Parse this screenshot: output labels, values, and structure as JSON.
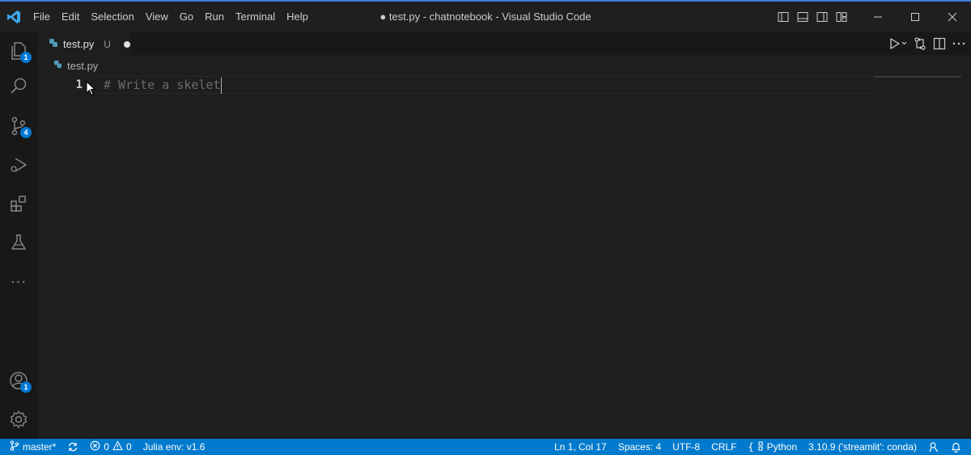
{
  "menubar": {
    "items": [
      "File",
      "Edit",
      "Selection",
      "View",
      "Go",
      "Run",
      "Terminal",
      "Help"
    ]
  },
  "window": {
    "title": "● test.py - chatnotebook - Visual Studio Code"
  },
  "activitybar": {
    "explorer_badge": "1",
    "source_control_badge": "4",
    "accounts_badge": "1",
    "more_label": "···"
  },
  "tab": {
    "label": "test.py",
    "status": "U"
  },
  "breadcrumb": {
    "file": "test.py"
  },
  "editor": {
    "line_number": "1",
    "code": "# Write a skelet"
  },
  "statusbar": {
    "branch": "master*",
    "errors": "0",
    "warnings": "0",
    "julia_env": "Julia env: v1.6",
    "position": "Ln 1, Col 17",
    "spaces": "Spaces: 4",
    "encoding": "UTF-8",
    "eol": "CRLF",
    "language": "Python",
    "interpreter": "3.10.9 ('streamlit': conda)"
  },
  "colors": {
    "accent": "#007acc",
    "badge": "#0078d4",
    "editor_bg": "#1e1e1e",
    "python_icon": "#519aba"
  }
}
